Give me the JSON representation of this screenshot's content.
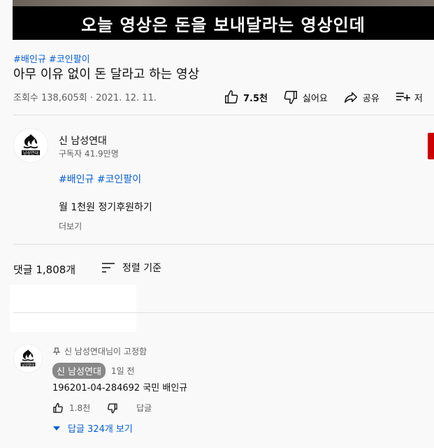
{
  "video": {
    "caption": "오늘 영상은 돈을 보내달라는 영상인데"
  },
  "tags": "#배인규 #코인팔이",
  "title": "아무 이유 없이 돈 달라고 하는 영상",
  "meta": {
    "views": "조회수 138,605회",
    "date": "2021. 12. 11."
  },
  "actions": {
    "like_count": "7.5천",
    "dislike_label": "싫어요",
    "share_label": "공유",
    "save_label": "저"
  },
  "channel": {
    "name": "신 남성연대",
    "subscribers": "구독자 41.9만명",
    "logo_text": "남성연대"
  },
  "description": {
    "tags": "#배인규 #코인팔이",
    "line": "월 1천원 정기후원하기",
    "more": "더보기"
  },
  "comments": {
    "count": "댓글 1,808개",
    "sort_label": "정렬 기준",
    "pinned_label": "신 남성연대님이 고정함",
    "author": "신 남성연대",
    "time": "1일 전",
    "text": "196201-04-284692 국민 배인규",
    "like_count": "1.8천",
    "reply_label": "답글",
    "view_replies": "답글 324개 보기"
  },
  "colors": {
    "link": "#065fd4",
    "subscribe_red": "#cc0000"
  }
}
